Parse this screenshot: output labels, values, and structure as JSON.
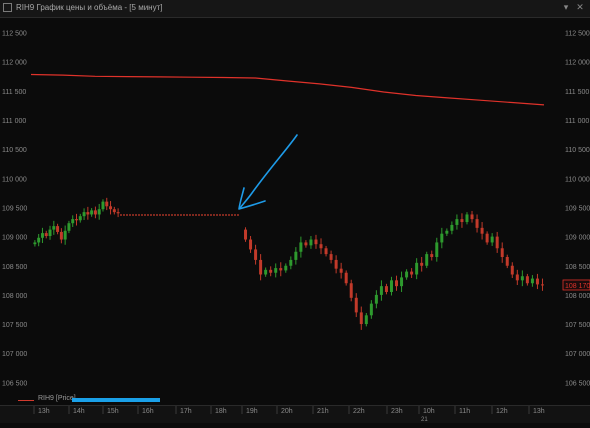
{
  "window": {
    "title": "RIH9 График цены и объёма - [5 минут]",
    "icon": "chart-window-icon",
    "buttons": [
      "▾",
      "✕"
    ]
  },
  "legend": {
    "series_label": "RIH9 [Price]",
    "line_color": "#d23a2e",
    "scroll_fill": 1.0,
    "scroll_color": "#1aa0e8"
  },
  "colors": {
    "up": "#2e9a2e",
    "down": "#c23a2a",
    "ma": "#e0322a",
    "annotation": "#1e9be8",
    "last_price_box": "#e0322a"
  },
  "chart_data": {
    "type": "candlestick",
    "instrument": "RIH9",
    "timeframe": "5 минут",
    "y_ticks": [
      106500,
      107000,
      107500,
      108000,
      108500,
      109000,
      109500,
      110000,
      110500,
      111000,
      111500,
      112000,
      112500
    ],
    "y_tick_labels": [
      "106 500",
      "107 000",
      "107 500",
      "108 000",
      "108 500",
      "109 000",
      "109 500",
      "110 000",
      "110 500",
      "111 000",
      "111 500",
      "112 000",
      "112 500"
    ],
    "ylim": [
      106300,
      112750
    ],
    "last_price": 108170,
    "last_price_label": "108 170",
    "x_ticks": [
      "13h",
      "14h",
      "15h",
      "16h",
      "17h",
      "18h",
      "19h",
      "20h",
      "21h",
      "22h",
      "23h",
      "10h",
      "11h",
      "12h",
      "13h"
    ],
    "date_marker": "21",
    "session_before": [
      [
        108870,
        108900
      ],
      [
        108900,
        108980
      ],
      [
        108980,
        109060
      ],
      [
        109060,
        109010
      ],
      [
        109010,
        109120
      ],
      [
        109120,
        109180
      ],
      [
        109180,
        109080
      ],
      [
        109080,
        108950
      ],
      [
        108950,
        109100
      ],
      [
        109100,
        109230
      ],
      [
        109230,
        109300
      ],
      [
        109300,
        109280
      ],
      [
        109280,
        109350
      ],
      [
        109350,
        109420
      ],
      [
        109420,
        109380
      ],
      [
        109380,
        109450
      ],
      [
        109450,
        109380
      ],
      [
        109380,
        109470
      ],
      [
        109470,
        109600
      ],
      [
        109600,
        109520
      ],
      [
        109520,
        109470
      ],
      [
        109470,
        109420
      ],
      [
        109420,
        109400
      ]
    ],
    "flat_line": {
      "value": 109370
    },
    "session_after": [
      [
        109120,
        108950
      ],
      [
        108950,
        108780
      ],
      [
        108780,
        108600
      ],
      [
        108600,
        108350
      ],
      [
        108350,
        108430
      ],
      [
        108430,
        108380
      ],
      [
        108380,
        108460
      ],
      [
        108460,
        108420
      ],
      [
        108420,
        108500
      ],
      [
        108500,
        108600
      ],
      [
        108600,
        108740
      ],
      [
        108740,
        108900
      ],
      [
        108900,
        108850
      ],
      [
        108850,
        108950
      ],
      [
        108950,
        108870
      ],
      [
        108870,
        108800
      ],
      [
        108800,
        108700
      ],
      [
        108700,
        108600
      ],
      [
        108600,
        108450
      ],
      [
        108450,
        108380
      ],
      [
        108380,
        108200
      ],
      [
        108200,
        107950
      ],
      [
        107950,
        107700
      ],
      [
        107700,
        107500
      ],
      [
        107500,
        107650
      ],
      [
        107650,
        107850
      ],
      [
        107850,
        108000
      ],
      [
        108000,
        108150
      ],
      [
        108150,
        108050
      ],
      [
        108050,
        108250
      ],
      [
        108250,
        108150
      ],
      [
        108150,
        108300
      ],
      [
        108300,
        108400
      ],
      [
        108400,
        108350
      ],
      [
        108350,
        108550
      ],
      [
        108550,
        108500
      ],
      [
        108500,
        108700
      ],
      [
        108700,
        108650
      ],
      [
        108650,
        108900
      ],
      [
        108900,
        109050
      ],
      [
        109050,
        109100
      ],
      [
        109100,
        109200
      ],
      [
        109200,
        109300
      ],
      [
        109300,
        109250
      ],
      [
        109250,
        109380
      ],
      [
        109380,
        109300
      ],
      [
        109300,
        109150
      ],
      [
        109150,
        109050
      ],
      [
        109050,
        108900
      ],
      [
        108900,
        109000
      ],
      [
        109000,
        108800
      ],
      [
        108800,
        108650
      ],
      [
        108650,
        108500
      ],
      [
        108500,
        108350
      ],
      [
        108350,
        108250
      ],
      [
        108250,
        108320
      ],
      [
        108320,
        108200
      ],
      [
        108200,
        108280
      ],
      [
        108280,
        108180
      ],
      [
        108180,
        108170
      ]
    ],
    "moving_average": [
      111780,
      111770,
      111750,
      111745,
      111740,
      111735,
      111730,
      111720,
      111670,
      111620,
      111560,
      111480,
      111420,
      111380,
      111340,
      111300,
      111260
    ]
  }
}
